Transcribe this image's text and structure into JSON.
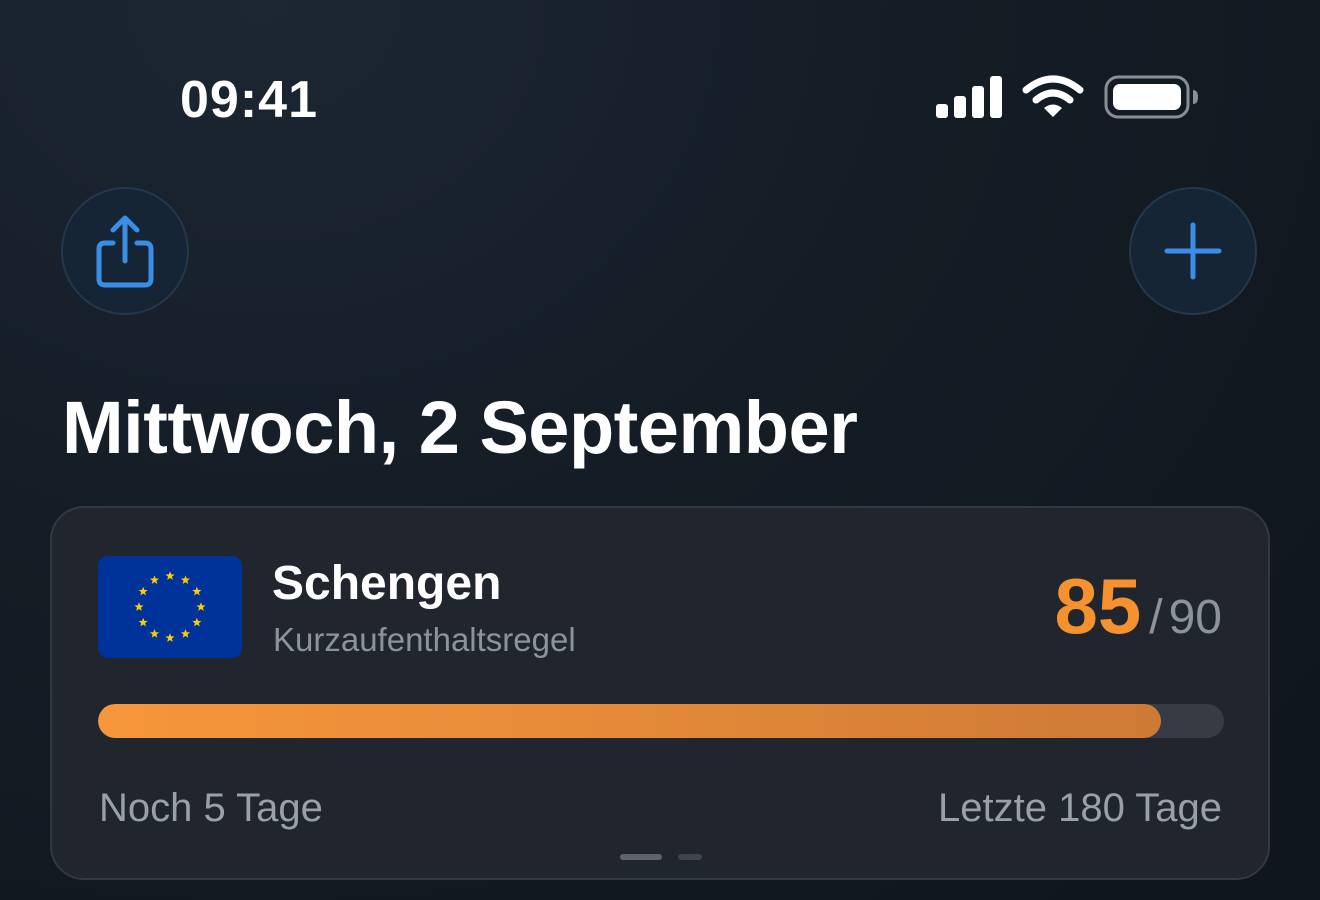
{
  "status_bar": {
    "time": "09:41",
    "icons": [
      "cellular-signal-icon",
      "wifi-icon",
      "battery-icon"
    ]
  },
  "toolbar": {
    "share_icon": "share-icon",
    "add_icon": "plus-icon"
  },
  "header": {
    "title": "Mittwoch, 2 September"
  },
  "card": {
    "flag_icon": "eu-flag-icon",
    "title": "Schengen",
    "subtitle": "Kurzaufenthaltsregel",
    "used_days": "85",
    "separator": "/",
    "max_days": "90",
    "progress_fraction": 0.944,
    "remaining_text": "Noch 5 Tage",
    "window_text": "Letzte 180 Tage",
    "page_count": 2,
    "active_page": 0
  },
  "colors": {
    "accent": "#f5922f",
    "icon_blue": "#3a8ee6",
    "eu_blue": "#003399",
    "eu_gold": "#ffcc00"
  }
}
